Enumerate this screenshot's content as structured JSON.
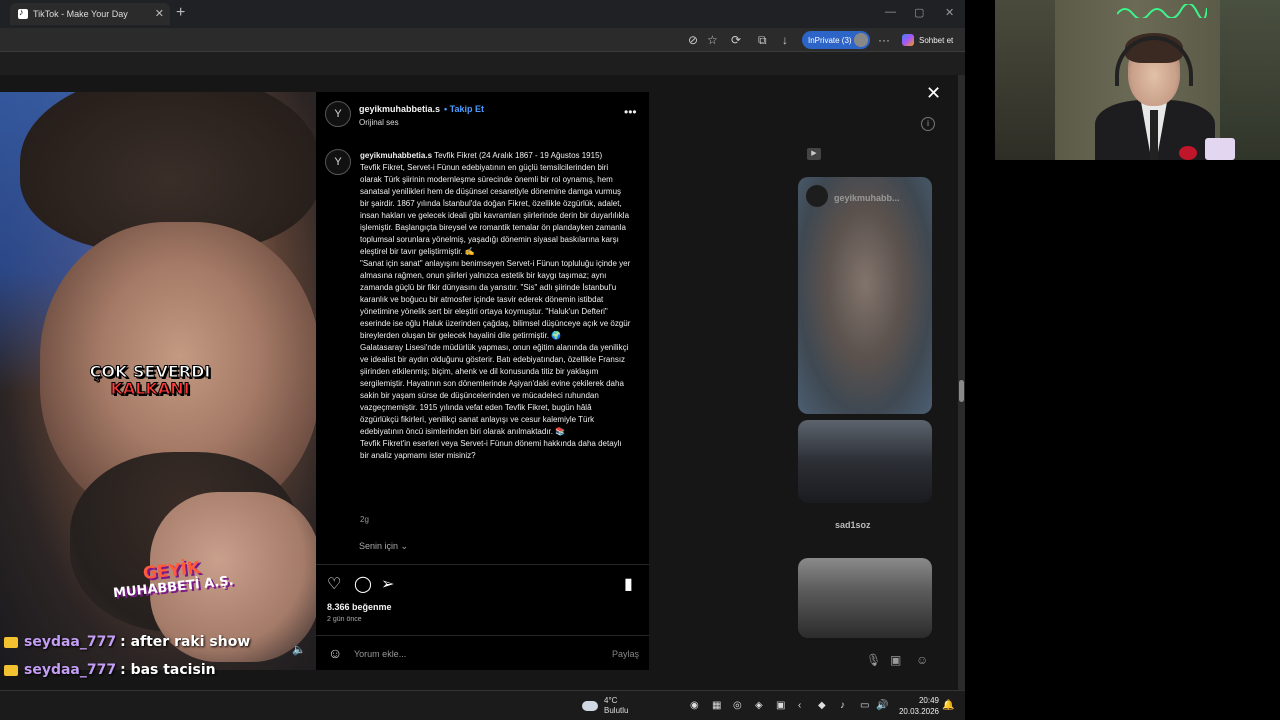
{
  "browser": {
    "tab_title": "TikTok - Make Your Day",
    "inprivate_label": "InPrivate (3)",
    "chat_label": "Sohbet et"
  },
  "video": {
    "caption_line1": "ÇOK SEVERDI",
    "caption_line2": "KALKANI",
    "logo_line1": "GEYİK",
    "logo_line2": "MUHABBETİ A.Ş."
  },
  "chat": [
    {
      "user": "seydaa_777",
      "message": ": after raki show"
    },
    {
      "user": "seydaa_777",
      "message": ": bas tacisin"
    }
  ],
  "post": {
    "username": "geyikmuhabbetia.s",
    "follow_label": "Takip Et",
    "audio_label": "Orijinal ses",
    "caption_title": "Tevfik Fikret (24 Aralık 1867 - 19 Ağustos 1915)",
    "caption_body": "Tevfik Fikret, Servet-i Fünun edebiyatının en güçlü temsilcilerinden biri olarak Türk şiirinin modernleşme sürecinde önemli bir rol oynamış, hem sanatsal yenilikleri hem de düşünsel cesaretiyle dönemine damga vurmuş bir şairdir. 1867 yılında İstanbul'da doğan Fikret, özellikle özgürlük, adalet, insan hakları ve gelecek ideali gibi kavramları şiirlerinde derin bir duyarlılıkla işlemiştir. Başlangıçta bireysel ve romantik temalar ön plandayken zamanla toplumsal sorunlara yönelmiş, yaşadığı dönemin siyasal baskılarına karşı eleştirel bir tavır geliştirmiştir. ✍️\n\"Sanat için sanat\" anlayışını benimseyen Servet-i Fünun topluluğu içinde yer almasına rağmen, onun şiirleri yalnızca estetik bir kaygı taşımaz; aynı zamanda güçlü bir fikir dünyasını da yansıtır. \"Sis\" adlı şiirinde İstanbul'u karanlık ve boğucu bir atmosfer içinde tasvir ederek dönemin istibdat yönetimine yönelik sert bir eleştiri ortaya koymuştur. \"Haluk'un Defteri\" eserinde ise oğlu Haluk üzerinden çağdaş, bilimsel düşünceye açık ve özgür bireylerden oluşan bir gelecek hayalini dile getirmiştir. 🌍\nGalatasaray Lisesi'nde müdürlük yapması, onun eğitim alanında da yenilikçi ve idealist bir aydın olduğunu gösterir. Batı edebiyatından, özellikle Fransız şiirinden etkilenmiş; biçim, ahenk ve dil konusunda titiz bir yaklaşım sergilemiştir. Hayatının son dönemlerinde Aşiyan'daki evine çekilerek daha sakin bir yaşam sürse de düşüncelerinden ve mücadeleci ruhundan vazgeçmemiştir. 1915 yılında vefat eden Tevfik Fikret, bugün hâlâ özgürlükçü fikirleri, yenilikçi sanat anlayışı ve cesur kalemiyle Türk edebiyatının öncü isimlerinden biri olarak anılmaktadır. 📚\nTevfik Fikret'in eserleri veya Servet-i Fünun dönemi hakkında daha detaylı bir analiz yapmamı ister misiniz?",
    "time": "2g",
    "for_you": "Senin için",
    "likes": "8.366 beğenme",
    "posted_ago": "2 gün önce",
    "comment_placeholder": "Yorum ekle...",
    "share_label": "Paylaş"
  },
  "sidebar": {
    "thumb1_user": "geyikmuhabb...",
    "thumb2_user": "sad1soz"
  },
  "taskbar": {
    "temperature": "4°C",
    "weather": "Bulutlu",
    "time": "20:49",
    "date": "20.03.2026"
  }
}
